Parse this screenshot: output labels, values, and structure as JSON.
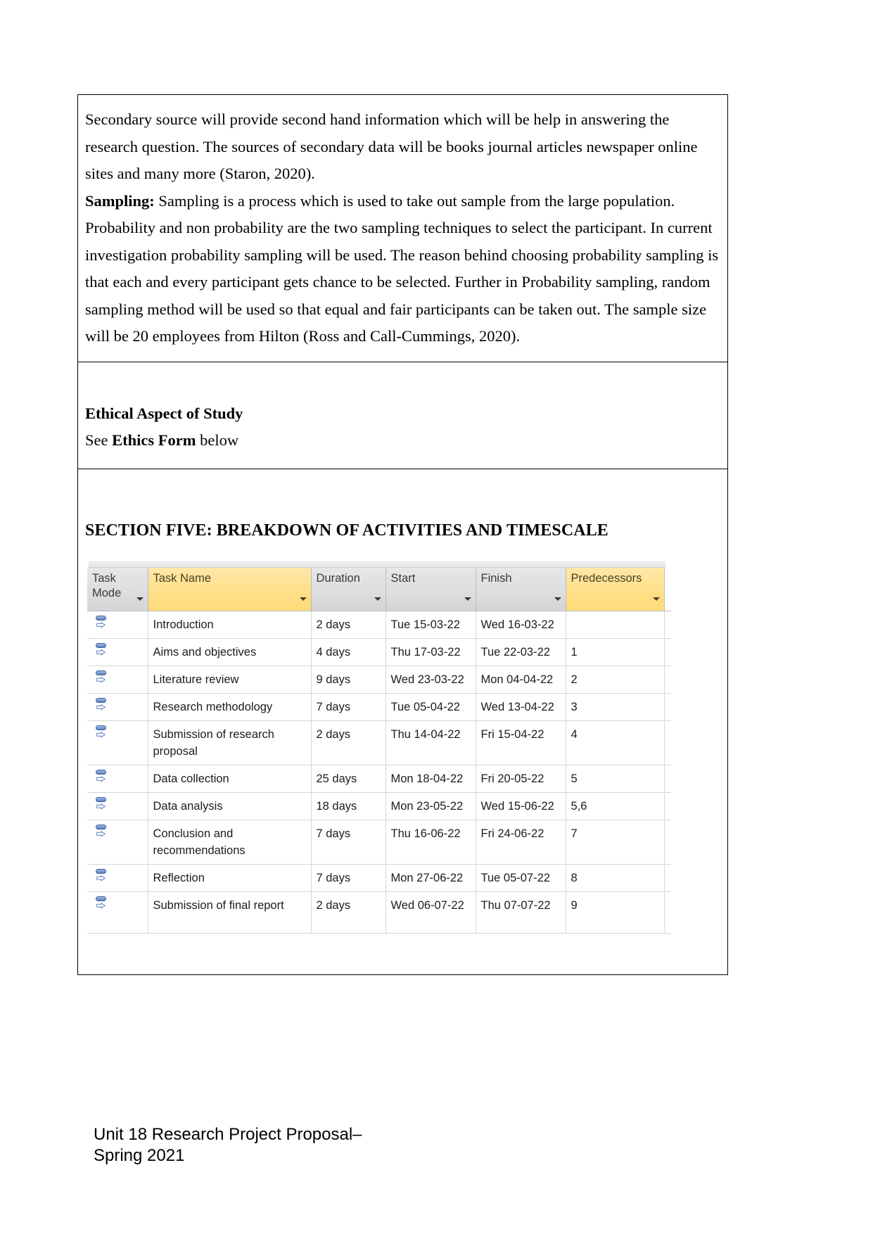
{
  "document": {
    "body_cell_1": {
      "paragraphs": [
        {
          "id": "p1",
          "text": "Secondary source will provide second hand information which will be help in answering the research question. The sources of secondary data will be books journal articles newspaper online sites and many more (Staron, 2020)."
        },
        {
          "id": "p2_lead",
          "lead_bold": "Sampling:",
          "text": " Sampling is a process which is used to take out sample from the large population. Probability and non probability are the two sampling techniques to select the participant. In current investigation probability sampling will be used. The reason behind choosing probability sampling is that each and every participant gets chance to be selected.  Further  in Probability sampling, random sampling method will be used so that equal and fair participants can be taken out. The sample size will be 20 employees from Hilton (Ross and Call-Cummings, 2020)."
        }
      ]
    },
    "body_cell_2": {
      "heading": "Ethical Aspect of Study",
      "see_prefix": "See ",
      "see_bold": "Ethics Form",
      "see_suffix": " below"
    },
    "body_cell_3": {
      "section_heading": "SECTION FIVE: BREAKDOWN OF ACTIVITIES AND TIMESCALE"
    }
  },
  "project_table": {
    "columns": [
      {
        "label": "Task Mode",
        "highlighted": false,
        "has_dropdown": true
      },
      {
        "label": "Task Name",
        "highlighted": true,
        "has_dropdown": true
      },
      {
        "label": "Duration",
        "highlighted": false,
        "has_dropdown": true
      },
      {
        "label": "Start",
        "highlighted": false,
        "has_dropdown": true
      },
      {
        "label": "Finish",
        "highlighted": false,
        "has_dropdown": true
      },
      {
        "label": "Predecessors",
        "highlighted": true,
        "has_dropdown": true
      }
    ],
    "rows": [
      {
        "mode_icon": "manually-scheduled-task-icon",
        "name": "Introduction",
        "duration": "2 days",
        "start": "Tue 15-03-22",
        "finish": "Wed 16-03-22",
        "predecessors": ""
      },
      {
        "mode_icon": "manually-scheduled-task-icon",
        "name": "Aims and objectives",
        "duration": "4 days",
        "start": "Thu 17-03-22",
        "finish": "Tue 22-03-22",
        "predecessors": "1"
      },
      {
        "mode_icon": "manually-scheduled-task-icon",
        "name": "Literature review",
        "duration": "9 days",
        "start": "Wed 23-03-22",
        "finish": "Mon 04-04-22",
        "predecessors": "2"
      },
      {
        "mode_icon": "manually-scheduled-task-icon",
        "name": "Research methodology",
        "duration": "7 days",
        "start": "Tue 05-04-22",
        "finish": "Wed 13-04-22",
        "predecessors": "3"
      },
      {
        "mode_icon": "manually-scheduled-task-icon",
        "name": "Submission of research proposal",
        "duration": "2 days",
        "start": "Thu 14-04-22",
        "finish": "Fri 15-04-22",
        "predecessors": "4"
      },
      {
        "mode_icon": "manually-scheduled-task-icon",
        "name": "Data collection",
        "duration": "25 days",
        "start": "Mon 18-04-22",
        "finish": "Fri 20-05-22",
        "predecessors": "5"
      },
      {
        "mode_icon": "manually-scheduled-task-icon",
        "name": "Data analysis",
        "duration": "18 days",
        "start": "Mon 23-05-22",
        "finish": "Wed 15-06-22",
        "predecessors": "5,6"
      },
      {
        "mode_icon": "manually-scheduled-task-icon",
        "name": "Conclusion and recommendations",
        "duration": "7 days",
        "start": "Thu 16-06-22",
        "finish": "Fri 24-06-22",
        "predecessors": "7"
      },
      {
        "mode_icon": "manually-scheduled-task-icon",
        "name": "Reflection",
        "duration": "7 days",
        "start": "Mon 27-06-22",
        "finish": "Tue 05-07-22",
        "predecessors": "8"
      },
      {
        "mode_icon": "manually-scheduled-task-icon",
        "name": "Submission of final report",
        "duration": "2 days",
        "start": "Wed 06-07-22",
        "finish": "Thu 07-07-22",
        "predecessors": "9"
      }
    ]
  },
  "footer": {
    "line1": "Unit 18 Research Project Proposal–",
    "line2": "Spring 2021"
  },
  "colors": {
    "header_gray": "#dcdddf",
    "header_highlight_yellow": "#ffe08a",
    "grid_line": "#d6d6d6",
    "page_border": "#000000",
    "task_icon_blue": "#5d7fc0"
  }
}
